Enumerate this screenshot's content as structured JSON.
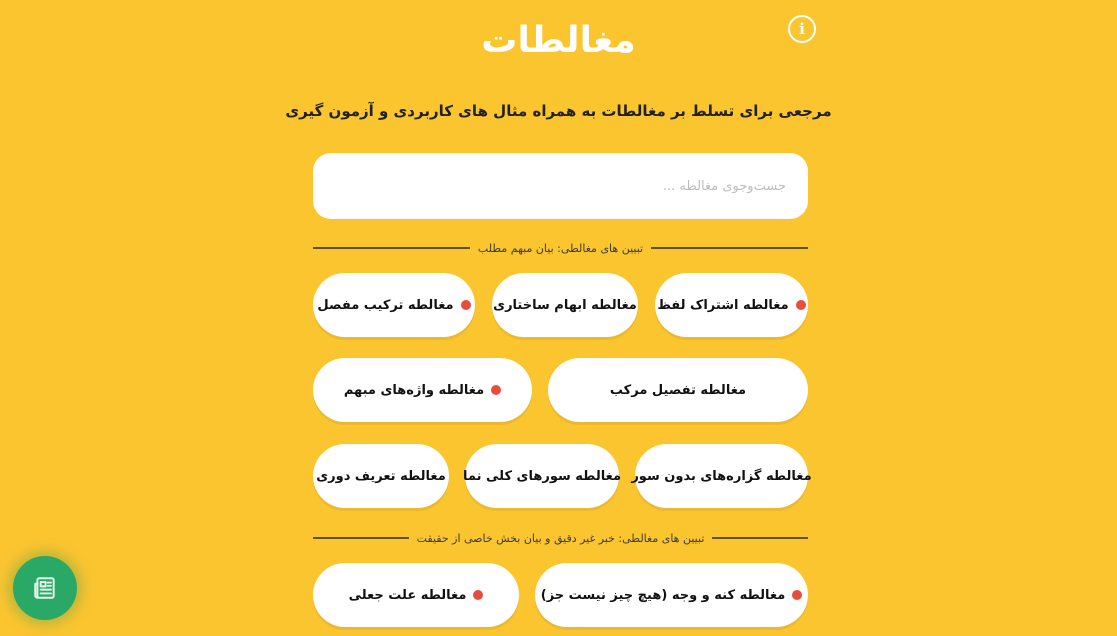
{
  "header": {
    "title": "مغالطات",
    "subtitle": "مرجعی برای تسلط بر مغالطات به همراه مثال های کاربردی و آزمون گیری",
    "info_icon": "info-icon",
    "info_glyph": "i"
  },
  "search": {
    "placeholder": "جست‌وجوی مغالطه ..."
  },
  "sections": [
    {
      "title": "تبیین های مغالطی: بیان مبهم مطلب",
      "items": [
        {
          "label": "مغالطه اشتراک لفظ",
          "marked": true
        },
        {
          "label": "مغالطه ابهام ساختاری",
          "marked": false
        },
        {
          "label": "مغالطه ترکیب مفصل",
          "marked": true
        },
        {
          "label": "مغالطه تفصیل مرکب",
          "marked": false
        },
        {
          "label": "مغالطه واژه‌های مبهم",
          "marked": true
        },
        {
          "label": "مغالطه گزاره‌های بدون سور",
          "marked": false
        },
        {
          "label": "مغالطه سورهای کلی نما",
          "marked": false
        },
        {
          "label": "مغالطه تعریف دوری",
          "marked": false
        }
      ]
    },
    {
      "title": "تبیین های مغالطی: خبر غیر دقیق و بیان بخش خاصی از حقیقت",
      "items": [
        {
          "label": "مغالطه کنه و وجه (هیچ چیز نیست جز)",
          "marked": true
        },
        {
          "label": "مغالطه علت جعلی",
          "marked": true
        }
      ]
    }
  ],
  "colors": {
    "background": "#fbc530",
    "chip": "#ffffff",
    "marker_dot": "#e84c3d",
    "fab": "#2aa866"
  },
  "fab": {
    "icon": "newspaper-icon"
  }
}
